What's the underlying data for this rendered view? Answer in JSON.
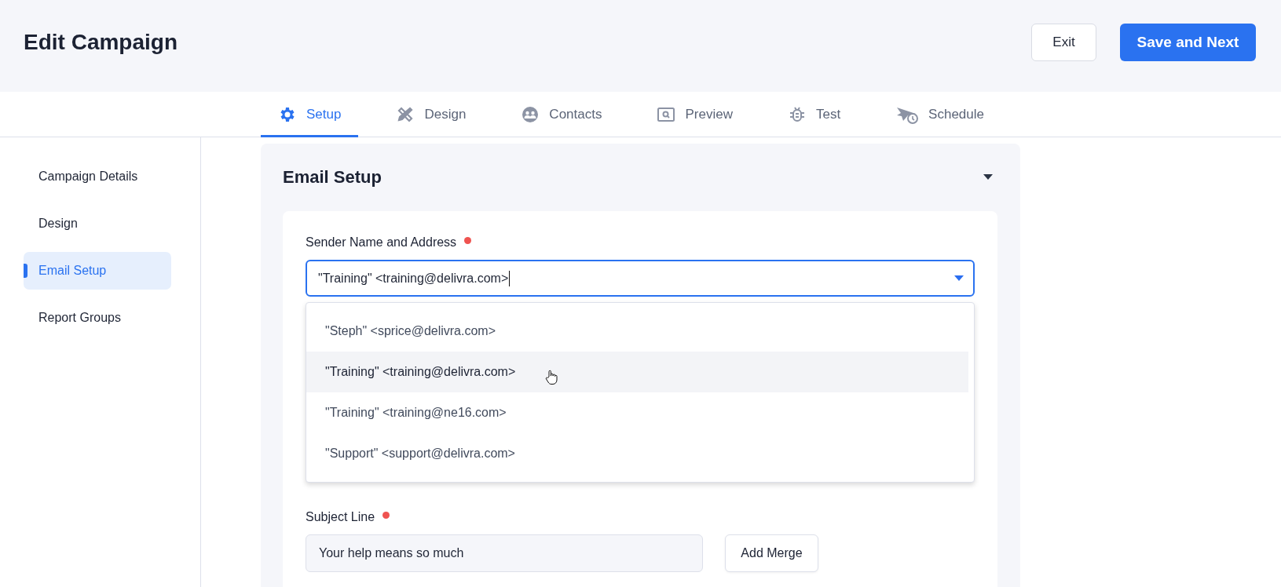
{
  "header": {
    "title": "Edit Campaign",
    "buttons": [
      {
        "label": "Exit",
        "kind": "secondary"
      },
      {
        "label": "Save and Next",
        "kind": "primary"
      }
    ]
  },
  "tabs": [
    {
      "label": "Setup",
      "kind": "gear",
      "selected": true
    },
    {
      "label": "Design",
      "kind": "tools",
      "selected": false
    },
    {
      "label": "Contacts",
      "kind": "people",
      "selected": false
    },
    {
      "label": "Preview",
      "kind": "preview",
      "selected": false
    },
    {
      "label": "Test",
      "kind": "bug",
      "selected": false
    },
    {
      "label": "Schedule",
      "kind": "schedule",
      "selected": false
    }
  ],
  "sidebar": {
    "items": [
      {
        "label": "Campaign Details",
        "selected": false
      },
      {
        "label": "Design",
        "selected": false
      },
      {
        "label": "Email Setup",
        "selected": true
      },
      {
        "label": "Report Groups",
        "selected": false
      }
    ]
  },
  "section": {
    "title": "Email Setup",
    "expanded": true,
    "sender": {
      "label": "Sender Name and Address",
      "required": true,
      "value": "\"Training\" <training@delivra.com>",
      "options": [
        {
          "label": "\"Steph\" <sprice@delivra.com>",
          "highlighted": false
        },
        {
          "label": "\"Training\" <training@delivra.com>",
          "highlighted": true
        },
        {
          "label": "\"Training\" <training@ne16.com>",
          "highlighted": false
        },
        {
          "label": "\"Support\" <support@delivra.com>",
          "highlighted": false
        }
      ]
    },
    "subject": {
      "label": "Subject Line",
      "required": true,
      "value": "Your help means so much",
      "button": "Add Merge"
    }
  }
}
